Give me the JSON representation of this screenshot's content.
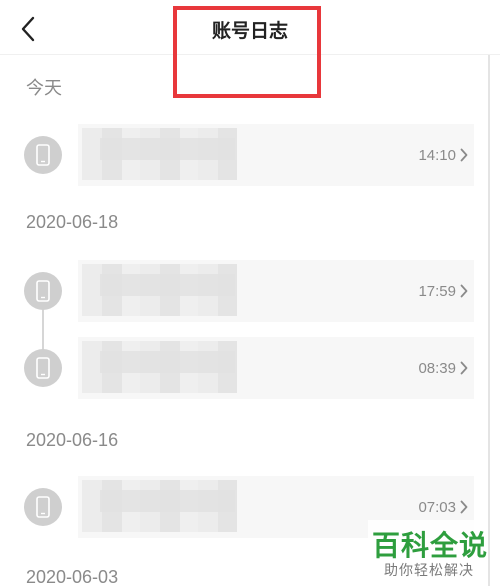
{
  "header": {
    "title": "账号日志",
    "back_icon": "chevron-left-icon"
  },
  "sections": [
    {
      "label": "今天",
      "entries": [
        {
          "time": "14:10"
        }
      ]
    },
    {
      "label": "2020-06-18",
      "entries": [
        {
          "time": "17:59"
        },
        {
          "time": "08:39"
        }
      ]
    },
    {
      "label": "2020-06-16",
      "entries": [
        {
          "time": "07:03"
        }
      ]
    },
    {
      "label": "2020-06-03",
      "entries": []
    }
  ],
  "icons": {
    "device": "phone-icon",
    "row_arrow": "chevron-right-icon"
  },
  "watermark": {
    "main": "百科全说",
    "sub": "助你轻松解决"
  },
  "colors": {
    "highlight": "#e8373b",
    "watermark": "#2e9e3e",
    "avatar": "#cfcfcf"
  }
}
